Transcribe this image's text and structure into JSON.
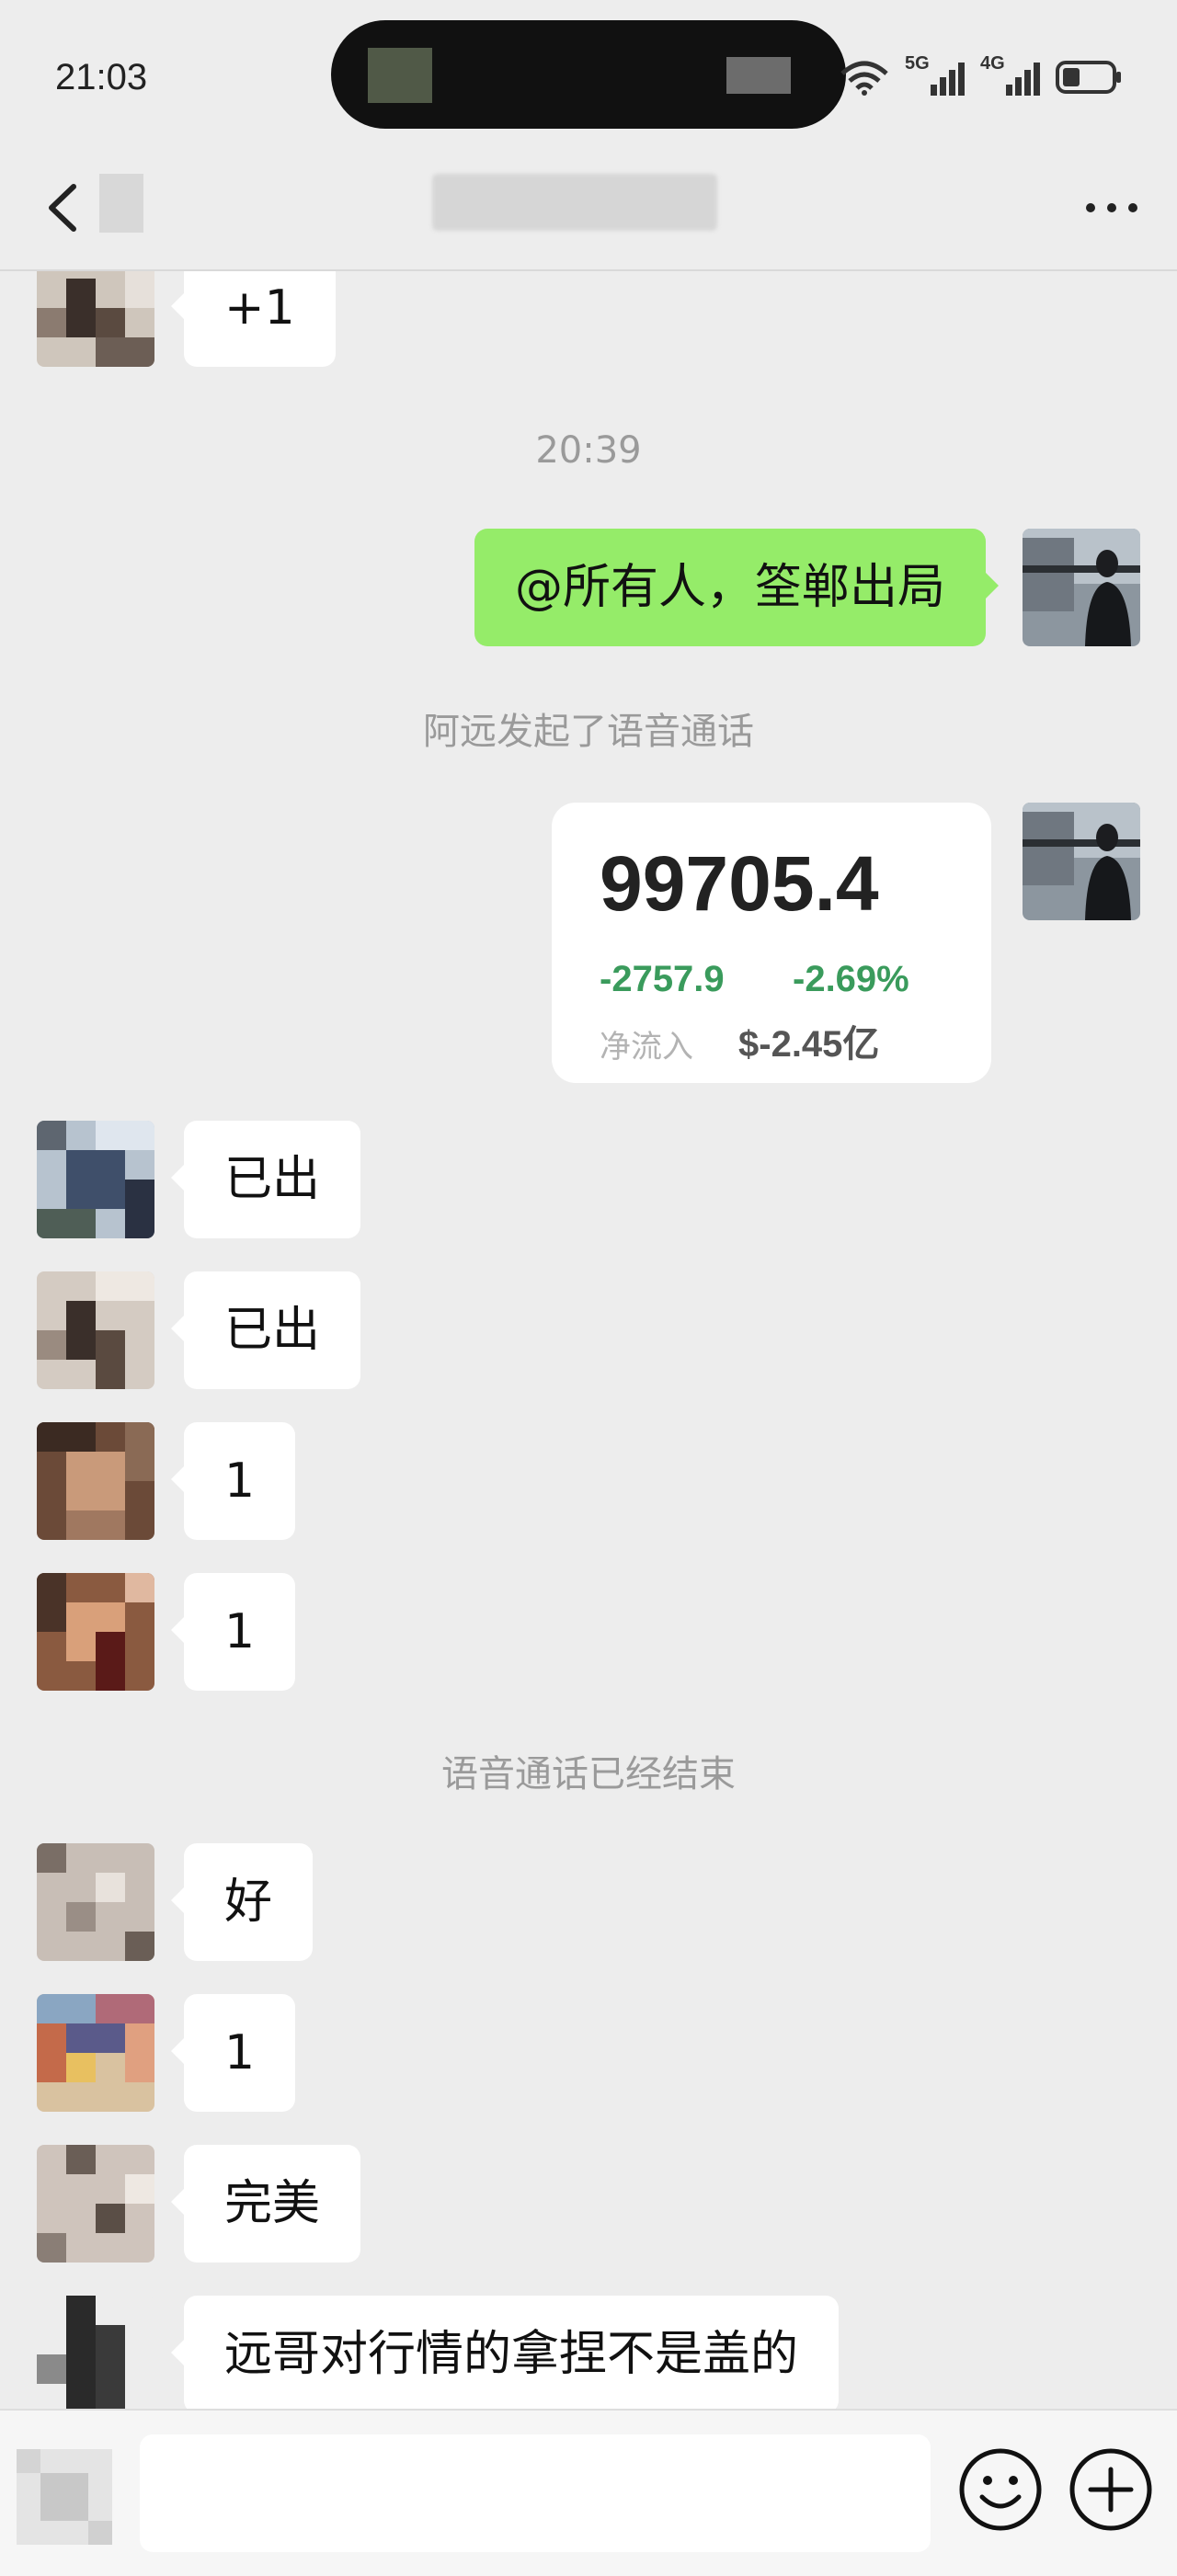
{
  "status_bar": {
    "time": "21:03",
    "network_1": "5G",
    "network_2": "4G"
  },
  "header": {
    "back_icon": "chevron-left-icon",
    "more_icon": "more-horizontal-icon"
  },
  "messages": [
    {
      "type": "incoming",
      "text": "+1"
    },
    {
      "type": "timestamp",
      "text": "20:39"
    },
    {
      "type": "outgoing",
      "text": "@所有人，筌郸出局"
    },
    {
      "type": "system",
      "text": "阿远发起了语音通话"
    },
    {
      "type": "outgoing_card"
    },
    {
      "type": "incoming",
      "text": "已出"
    },
    {
      "type": "incoming",
      "text": "已出"
    },
    {
      "type": "incoming",
      "text": "1"
    },
    {
      "type": "incoming",
      "text": "1"
    },
    {
      "type": "system",
      "text": "语音通话已经结束"
    },
    {
      "type": "incoming",
      "text": "好"
    },
    {
      "type": "incoming",
      "text": "1"
    },
    {
      "type": "incoming",
      "text": "完美"
    },
    {
      "type": "incoming",
      "text": "远哥对行情的拿捏不是盖的"
    }
  ],
  "stock_card": {
    "price": "99705.4",
    "change": "-2757.9",
    "change_pct": "-2.69%",
    "net_inflow_label": "净流入",
    "net_inflow_value": "$-2.45亿",
    "change_color": "#3a9b5c"
  },
  "input_bar": {
    "emoji_icon": "emoji-smile-icon",
    "plus_icon": "plus-circle-icon"
  },
  "colors": {
    "background": "#ededed",
    "outgoing_bubble": "#95ec69",
    "incoming_bubble": "#ffffff",
    "system_text": "#9a9a9a"
  }
}
